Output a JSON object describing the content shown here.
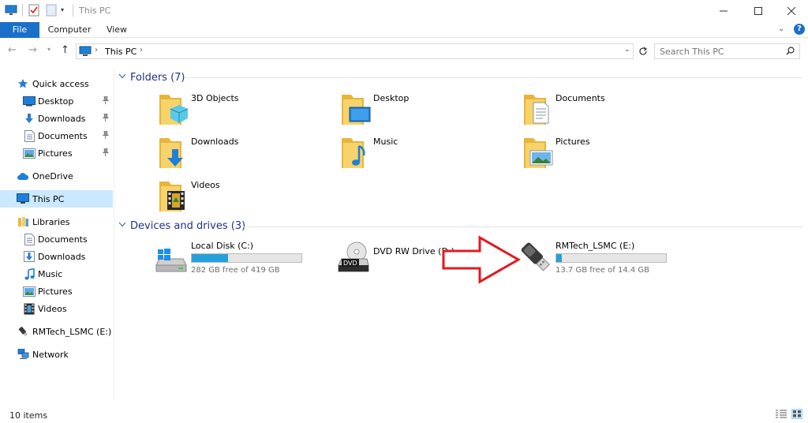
{
  "window": {
    "title": "This PC"
  },
  "ribbon": {
    "tabs": [
      {
        "label": "File"
      },
      {
        "label": "Computer"
      },
      {
        "label": "View"
      }
    ]
  },
  "address": {
    "crumbs": [
      "This PC"
    ]
  },
  "search": {
    "placeholder": "Search This PC"
  },
  "sidebar": {
    "items": [
      {
        "label": "Quick access",
        "icon": "star-icon"
      },
      {
        "label": "Desktop",
        "icon": "desktop-icon",
        "pinned": true
      },
      {
        "label": "Downloads",
        "icon": "downloads-icon",
        "pinned": true
      },
      {
        "label": "Documents",
        "icon": "documents-icon",
        "pinned": true
      },
      {
        "label": "Pictures",
        "icon": "pictures-icon",
        "pinned": true
      },
      {
        "label": "OneDrive",
        "icon": "cloud-icon"
      },
      {
        "label": "This PC",
        "icon": "computer-icon",
        "selected": true
      },
      {
        "label": "Libraries",
        "icon": "libraries-icon"
      },
      {
        "label": "Documents",
        "icon": "documents-icon"
      },
      {
        "label": "Downloads",
        "icon": "downloads-icon"
      },
      {
        "label": "Music",
        "icon": "music-icon"
      },
      {
        "label": "Pictures",
        "icon": "pictures-icon"
      },
      {
        "label": "Videos",
        "icon": "videos-icon"
      },
      {
        "label": "RMTech_LSMC (E:)",
        "icon": "usb-drive-icon"
      },
      {
        "label": "Network",
        "icon": "network-icon"
      }
    ]
  },
  "folders": {
    "title": "Folders (7)",
    "items": [
      {
        "label": "3D Objects",
        "icon": "3d-objects-folder-icon"
      },
      {
        "label": "Desktop",
        "icon": "desktop-folder-icon"
      },
      {
        "label": "Documents",
        "icon": "documents-folder-icon"
      },
      {
        "label": "Downloads",
        "icon": "downloads-folder-icon"
      },
      {
        "label": "Music",
        "icon": "music-folder-icon"
      },
      {
        "label": "Pictures",
        "icon": "pictures-folder-icon"
      },
      {
        "label": "Videos",
        "icon": "videos-folder-icon"
      }
    ]
  },
  "drives": {
    "title": "Devices and drives (3)",
    "items": [
      {
        "label": "Local Disk (C:)",
        "free": "282 GB free of 419 GB",
        "used_fraction": 0.33,
        "icon": "windows-disk-icon"
      },
      {
        "label": "DVD RW Drive (D:)",
        "icon": "dvd-drive-icon"
      },
      {
        "label": "RMTech_LSMC (E:)",
        "free": "13.7 GB free of 14.4 GB",
        "used_fraction": 0.05,
        "icon": "usb-drive-icon"
      }
    ]
  },
  "annotation": {
    "icon": "red-arrow-icon",
    "color": "#e3191f"
  },
  "status": {
    "count": "10 items"
  },
  "colors": {
    "accent": "#1a6fc9",
    "selection": "#cce8ff",
    "bar_fill": "#26a0da",
    "group_title": "#1e3287"
  }
}
